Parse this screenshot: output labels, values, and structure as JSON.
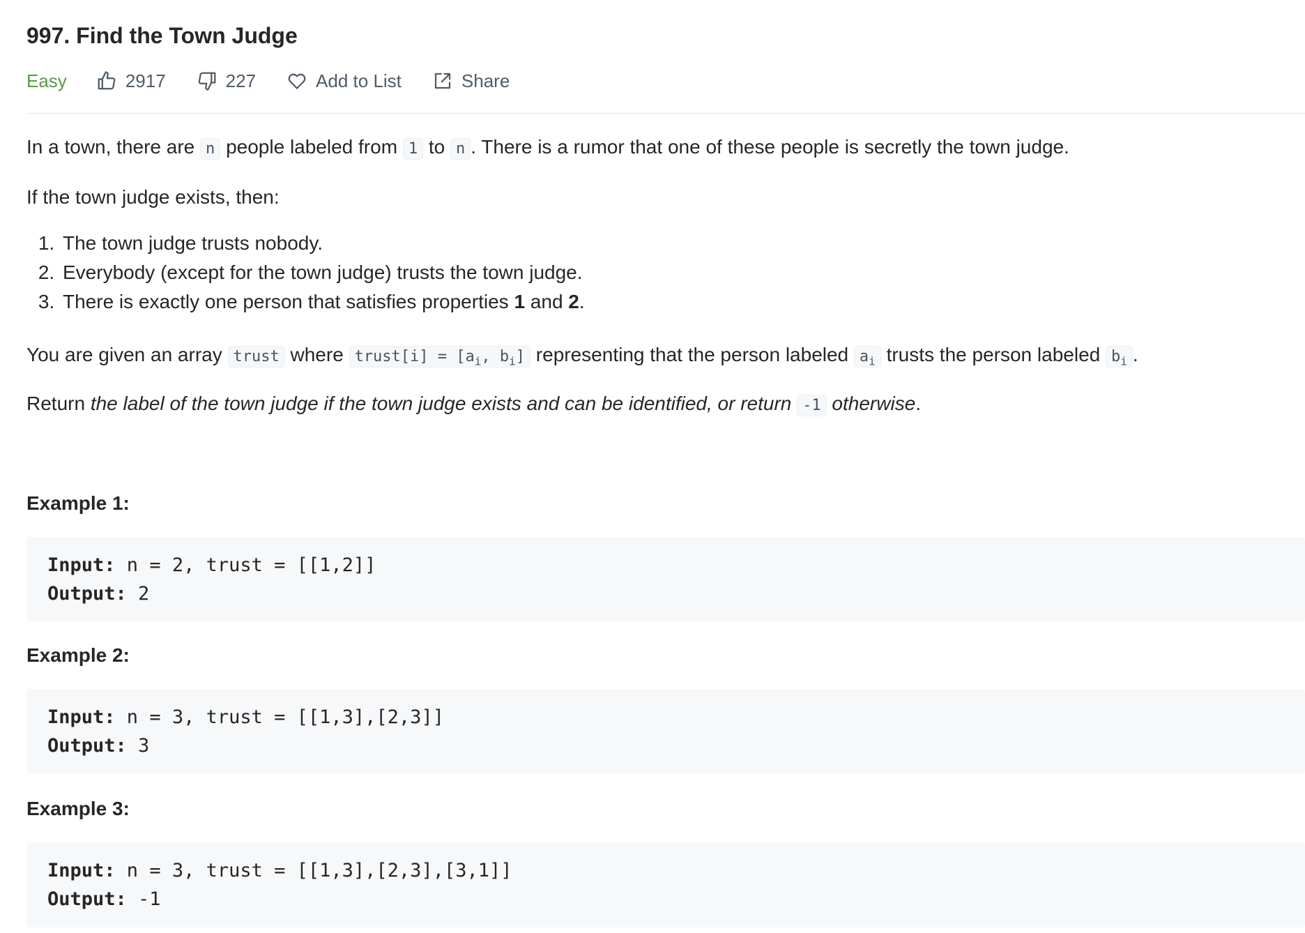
{
  "problem": {
    "title": "997. Find the Town Judge",
    "difficulty": "Easy",
    "likes": "2917",
    "dislikes": "227",
    "add_to_list": "Add to List",
    "share": "Share",
    "colors": {
      "difficulty": "#5a9a4a",
      "text": "#262626",
      "meta": "#4f5b66"
    }
  },
  "description": {
    "p1": {
      "t1": "In a town, there are ",
      "c1": "n",
      "t2": " people labeled from ",
      "c2": "1",
      "t3": " to ",
      "c3": "n",
      "t4": ". There is a rumor that one of these people is secretly the town judge."
    },
    "p2": "If the town judge exists, then:",
    "rules": {
      "r1": "The town judge trusts nobody.",
      "r2": "Everybody (except for the town judge) trusts the town judge.",
      "r3_pre": "There is exactly one person that satisfies properties ",
      "r3_b1": "1",
      "r3_mid": " and ",
      "r3_b2": "2",
      "r3_end": "."
    },
    "p3": {
      "t1": "You are given an array ",
      "c1": "trust",
      "t2": " where ",
      "c2a": "trust[i] = [a",
      "c2sub1": "i",
      "c2b": ", b",
      "c2sub2": "i",
      "c2c": "]",
      "t3": " representing that the person labeled ",
      "c3": "a",
      "c3sub": "i",
      "t4": " trusts the person labeled ",
      "c4": "b",
      "c4sub": "i",
      "t5": "."
    },
    "p4": {
      "t1": "Return ",
      "i1": "the label of the town judge if the town judge exists and can be identified, or return ",
      "c1": "-1",
      "i2": " otherwise",
      "t2": "."
    }
  },
  "examples": [
    {
      "title": "Example 1:",
      "input_label": "Input:",
      "input": " n = 2, trust = [[1,2]]",
      "output_label": "Output:",
      "output": " 2"
    },
    {
      "title": "Example 2:",
      "input_label": "Input:",
      "input": " n = 3, trust = [[1,3],[2,3]]",
      "output_label": "Output:",
      "output": " 3"
    },
    {
      "title": "Example 3:",
      "input_label": "Input:",
      "input": " n = 3, trust = [[1,3],[2,3],[3,1]]",
      "output_label": "Output:",
      "output": " -1"
    }
  ]
}
